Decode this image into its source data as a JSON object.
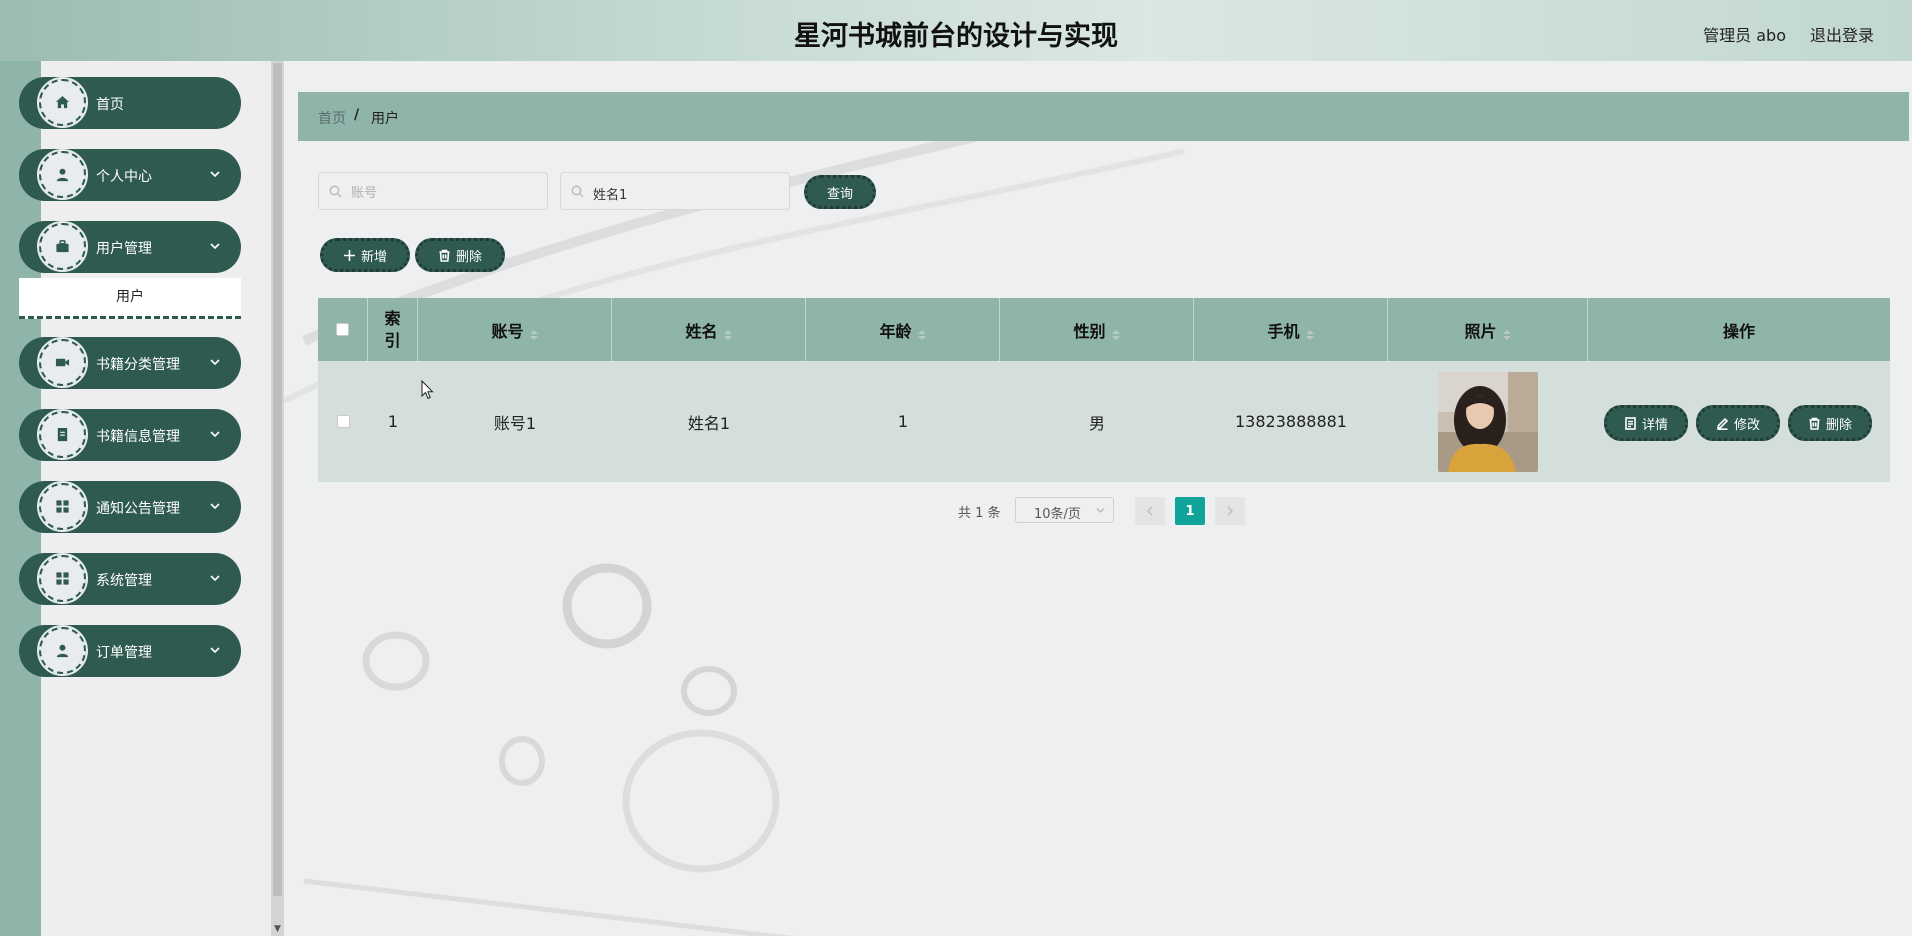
{
  "header": {
    "title": "星河书城前台的设计与实现",
    "admin_label": "管理员 abo",
    "logout_label": "退出登录"
  },
  "sidebar": {
    "items": [
      {
        "label": "首页",
        "icon": "home-icon",
        "has_submenu": false
      },
      {
        "label": "个人中心",
        "icon": "user-icon",
        "has_submenu": true
      },
      {
        "label": "用户管理",
        "icon": "briefcase-icon",
        "has_submenu": true
      },
      {
        "label": "书籍分类管理",
        "icon": "video-icon",
        "has_submenu": true
      },
      {
        "label": "书籍信息管理",
        "icon": "book-icon",
        "has_submenu": true
      },
      {
        "label": "通知公告管理",
        "icon": "grid-icon",
        "has_submenu": true
      },
      {
        "label": "系统管理",
        "icon": "grid-icon",
        "has_submenu": true
      },
      {
        "label": "订单管理",
        "icon": "user-icon",
        "has_submenu": true
      }
    ],
    "submenu_active": "用户"
  },
  "breadcrumb": {
    "home": "首页",
    "separator": "/",
    "current": "用户"
  },
  "search": {
    "account_placeholder": "账号",
    "account_value": "",
    "name_placeholder": "姓名",
    "name_value": "姓名1",
    "query_label": "查询"
  },
  "actions": {
    "add_label": "新增",
    "delete_label": "删除"
  },
  "table": {
    "columns": [
      "索引",
      "账号",
      "姓名",
      "年龄",
      "性别",
      "手机",
      "照片",
      "操作"
    ],
    "index_header_lines": [
      "索",
      "引"
    ],
    "rows": [
      {
        "index": "1",
        "account": "账号1",
        "name": "姓名1",
        "age": "1",
        "gender": "男",
        "phone": "13823888881",
        "photo": "portrait-photo",
        "detail_label": "详情",
        "edit_label": "修改",
        "delete_label": "删除"
      }
    ]
  },
  "pagination": {
    "total_text": "共 1 条",
    "page_size": "10条/页",
    "current_page": "1"
  },
  "colors": {
    "primary": "#2e5a4f",
    "accent_green": "#8fb4aa",
    "active_page": "#10a39a",
    "row_bg": "#d4dfdc"
  }
}
